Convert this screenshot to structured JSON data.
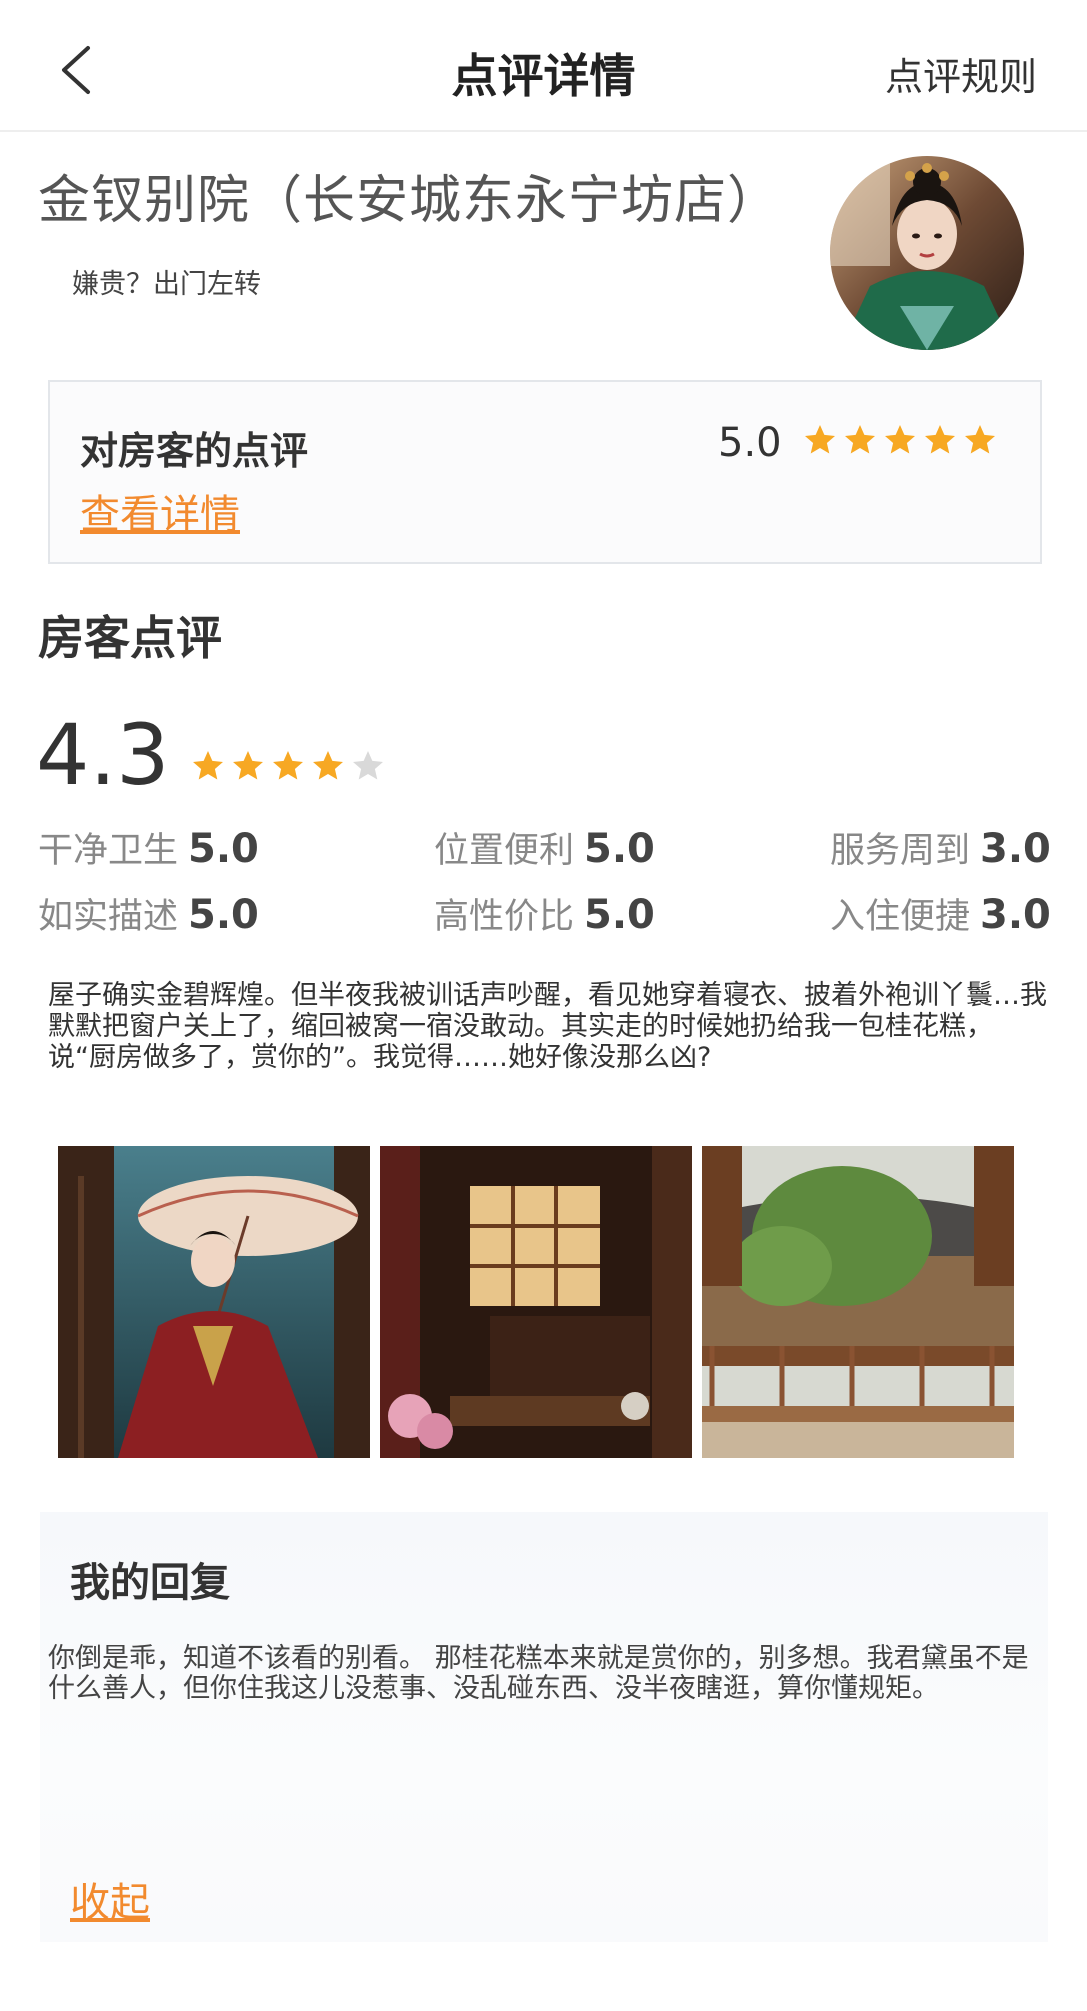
{
  "nav": {
    "title": "点评详情",
    "rules_label": "点评规则",
    "back_icon": "chevron-left-icon"
  },
  "hotel": {
    "name": "金钗别院（长安城东永宁坊店）",
    "slogan": "嫌贵？出门左转"
  },
  "host_review": {
    "title": "对房客的点评",
    "score": "5.0",
    "stars_filled": 5,
    "link_label": "查看详情"
  },
  "guest_review": {
    "section_title": "房客点评",
    "overall_score": "4.3",
    "stars_filled": 4,
    "stars_total": 5,
    "sub_scores": [
      {
        "label": "干净卫生",
        "value": "5.0"
      },
      {
        "label": "位置便利",
        "value": "5.0"
      },
      {
        "label": "服务周到",
        "value": "3.0"
      },
      {
        "label": "如实描述",
        "value": "5.0"
      },
      {
        "label": "高性价比",
        "value": "5.0"
      },
      {
        "label": "入住便捷",
        "value": "3.0"
      }
    ],
    "text": "屋子确实金碧辉煌。但半夜我被训话声吵醒，看见她穿着寝衣、披着外袍训丫鬟…我默默把窗户关上了，缩回被窝一宿没敢动。其实走的时候她扔给我一包桂花糕，说“厨房做多了，赏你的”。我觉得……她好像没那么凶?"
  },
  "reply": {
    "title": "我的回复",
    "text": "你倒是乖，知道不该看的别看。 那桂花糕本来就是赏你的，别多想。我君黛虽不是什么善人，但你住我这儿没惹事、没乱碰东西、没半夜瞎逛，算你懂规矩。",
    "collapse_label": "收起"
  },
  "colors": {
    "accent": "#f28a2e",
    "star_filled": "#f7a823",
    "star_empty": "#d9d9d9"
  }
}
